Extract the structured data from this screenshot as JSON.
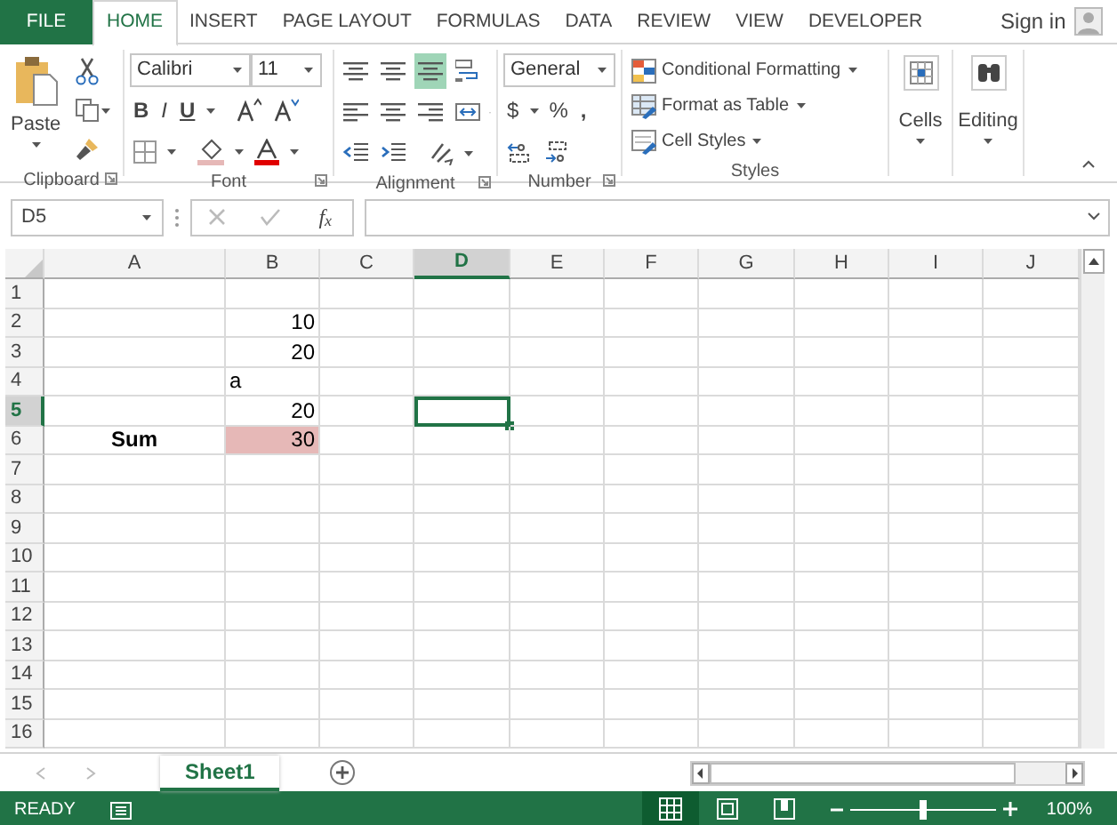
{
  "tabs": [
    {
      "label": "FILE",
      "kind": "file",
      "selected": false
    },
    {
      "label": "HOME",
      "kind": "tab",
      "selected": true
    },
    {
      "label": "INSERT",
      "kind": "tab",
      "selected": false
    },
    {
      "label": "PAGE LAYOUT",
      "kind": "tab",
      "selected": false
    },
    {
      "label": "FORMULAS",
      "kind": "tab",
      "selected": false
    },
    {
      "label": "DATA",
      "kind": "tab",
      "selected": false
    },
    {
      "label": "REVIEW",
      "kind": "tab",
      "selected": false
    },
    {
      "label": "VIEW",
      "kind": "tab",
      "selected": false
    },
    {
      "label": "DEVELOPER",
      "kind": "tab",
      "selected": false
    }
  ],
  "account": {
    "label": "Sign in"
  },
  "ribbon": {
    "clipboard": {
      "label": "Clipboard",
      "paste": "Paste"
    },
    "font": {
      "label": "Font",
      "font_name": "Calibri",
      "font_size": "11",
      "bold": "B",
      "italic": "I",
      "underline": "U"
    },
    "alignment": {
      "label": "Alignment",
      "middle_align_selected": true
    },
    "number": {
      "label": "Number",
      "format": "General",
      "currency": "$",
      "percent": "%",
      "comma": ","
    },
    "styles": {
      "label": "Styles",
      "items": [
        {
          "label": "Conditional Formatting",
          "kind": "conditional"
        },
        {
          "label": "Format as Table",
          "kind": "table"
        },
        {
          "label": "Cell Styles",
          "kind": "styles"
        }
      ]
    },
    "cells": {
      "label": "Cells"
    },
    "editing": {
      "label": "Editing"
    }
  },
  "formula_bar": {
    "name_box": "D5",
    "function_label": "f$_{x}$"
  },
  "grid": {
    "columns": [
      {
        "label": "A",
        "selected": false
      },
      {
        "label": "B",
        "selected": false
      },
      {
        "label": "C",
        "selected": false
      },
      {
        "label": "D",
        "selected": true
      },
      {
        "label": "E",
        "selected": false
      },
      {
        "label": "F",
        "selected": false
      },
      {
        "label": "G",
        "selected": false
      },
      {
        "label": "H",
        "selected": false
      },
      {
        "label": "I",
        "selected": false
      },
      {
        "label": "J",
        "selected": false
      }
    ],
    "rows": [
      {
        "number": "1",
        "selected": false,
        "cells": {}
      },
      {
        "number": "2",
        "selected": false,
        "cells": {
          "b": {
            "value": "10",
            "kind": "number"
          }
        }
      },
      {
        "number": "3",
        "selected": false,
        "cells": {
          "b": {
            "value": "20",
            "kind": "number"
          }
        }
      },
      {
        "number": "4",
        "selected": false,
        "cells": {
          "b": {
            "value": "a",
            "kind": "text"
          }
        }
      },
      {
        "number": "5",
        "selected": true,
        "cells": {
          "b": {
            "value": "20",
            "kind": "number"
          }
        }
      },
      {
        "number": "6",
        "selected": false,
        "cells": {
          "a": {
            "value": "Sum",
            "kind": "heading"
          },
          "b": {
            "value": "30",
            "kind": "number",
            "color": "#e6b8b7"
          }
        }
      },
      {
        "number": "7",
        "selected": false,
        "cells": {}
      },
      {
        "number": "8",
        "selected": false,
        "cells": {}
      },
      {
        "number": "9",
        "selected": false,
        "cells": {}
      },
      {
        "number": "10",
        "selected": false,
        "cells": {}
      },
      {
        "number": "11",
        "selected": false,
        "cells": {}
      },
      {
        "number": "12",
        "selected": false,
        "cells": {}
      },
      {
        "number": "13",
        "selected": false,
        "cells": {}
      },
      {
        "number": "14",
        "selected": false,
        "cells": {}
      },
      {
        "number": "15",
        "selected": false,
        "cells": {}
      },
      {
        "number": "16",
        "selected": false,
        "cells": {}
      }
    ]
  },
  "sheet_tabs": [
    {
      "label": "Sheet1",
      "selected": true
    }
  ],
  "status_bar": {
    "status": "READY",
    "views": [
      {
        "kind": "normal",
        "selected": true
      },
      {
        "kind": "page_layout",
        "selected": false
      },
      {
        "kind": "page_break",
        "selected": false
      }
    ],
    "zoom": "100%",
    "zoom_slider": {
      "level": 0.5
    }
  }
}
